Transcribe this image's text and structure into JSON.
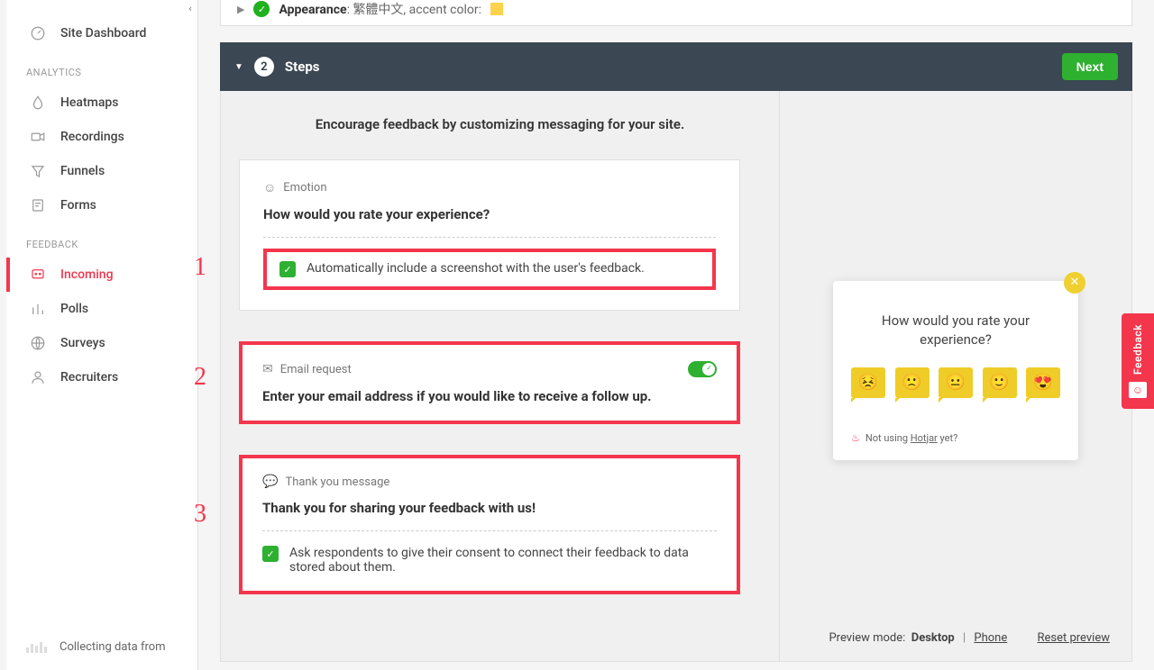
{
  "sidebar": {
    "dashboard_label": "Site Dashboard",
    "section_analytics": "ANALYTICS",
    "section_feedback": "FEEDBACK",
    "items_analytics": [
      {
        "label": "Heatmaps",
        "icon": "heatmap"
      },
      {
        "label": "Recordings",
        "icon": "camera"
      },
      {
        "label": "Funnels",
        "icon": "funnel"
      },
      {
        "label": "Forms",
        "icon": "form"
      }
    ],
    "items_feedback": [
      {
        "label": "Incoming",
        "icon": "incoming"
      },
      {
        "label": "Polls",
        "icon": "polls"
      },
      {
        "label": "Surveys",
        "icon": "surveys"
      },
      {
        "label": "Recruiters",
        "icon": "recruiters"
      }
    ],
    "footer": "Collecting data from"
  },
  "appearance": {
    "label": "Appearance",
    "value": "繁體中文, accent color:"
  },
  "steps_header": {
    "number": "2",
    "title": "Steps",
    "next": "Next"
  },
  "encourage": "Encourage feedback by customizing messaging for your site.",
  "annotations": {
    "one": "1",
    "two": "2",
    "three": "3"
  },
  "cards": {
    "emotion": {
      "label": "Emotion",
      "question": "How would you rate your experience?",
      "option": "Automatically include a screenshot with the user's feedback."
    },
    "email": {
      "label": "Email request",
      "question": "Enter your email address if you would like to receive a follow up."
    },
    "thanks": {
      "label": "Thank you message",
      "question": "Thank you for sharing your feedback with us!",
      "option": "Ask respondents to give their consent to connect their feedback to data stored about them."
    }
  },
  "preview": {
    "question": "How would you rate your experience?",
    "footer_prefix": "Not using ",
    "footer_link": "Hotjar",
    "footer_suffix": " yet?"
  },
  "preview_mode": {
    "label": "Preview mode:",
    "desktop": "Desktop",
    "phone": "Phone",
    "reset": "Reset preview"
  },
  "feedback_tab": "Feedback"
}
